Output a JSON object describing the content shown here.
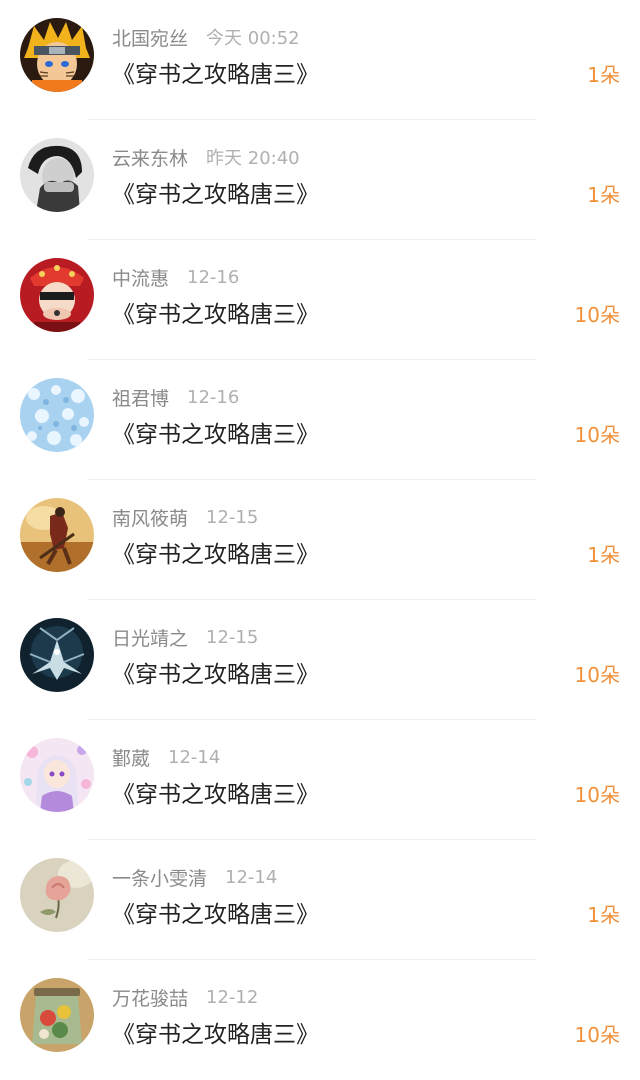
{
  "accent_color": "#f0903a",
  "records": [
    {
      "user": "北国宛丝",
      "time": "今天 00:52",
      "book": "《穿书之攻略唐三》",
      "gift": "1朵",
      "avatar_icon": "naruto-avatar-icon"
    },
    {
      "user": "云来东林",
      "time": "昨天 20:40",
      "book": "《穿书之攻略唐三》",
      "gift": "1朵",
      "avatar_icon": "bw-portrait-avatar-icon"
    },
    {
      "user": "中流惠",
      "time": "12-16",
      "book": "《穿书之攻略唐三》",
      "gift": "10朵",
      "avatar_icon": "red-costume-avatar-icon"
    },
    {
      "user": "祖君博",
      "time": "12-16",
      "book": "《穿书之攻略唐三》",
      "gift": "10朵",
      "avatar_icon": "snowflake-avatar-icon"
    },
    {
      "user": "南风筱萌",
      "time": "12-15",
      "book": "《穿书之攻略唐三》",
      "gift": "1朵",
      "avatar_icon": "warrior-art-avatar-icon"
    },
    {
      "user": "日光靖之",
      "time": "12-15",
      "book": "《穿书之攻略唐三》",
      "gift": "10朵",
      "avatar_icon": "dark-creature-avatar-icon"
    },
    {
      "user": "鄞葳",
      "time": "12-14",
      "book": "《穿书之攻略唐三》",
      "gift": "10朵",
      "avatar_icon": "anime-girl-avatar-icon"
    },
    {
      "user": "一条小雯清",
      "time": "12-14",
      "book": "《穿书之攻略唐三》",
      "gift": "1朵",
      "avatar_icon": "rose-avatar-icon"
    },
    {
      "user": "万花骏喆",
      "time": "12-12",
      "book": "《穿书之攻略唐三》",
      "gift": "10朵",
      "avatar_icon": "jar-avatar-icon"
    }
  ]
}
